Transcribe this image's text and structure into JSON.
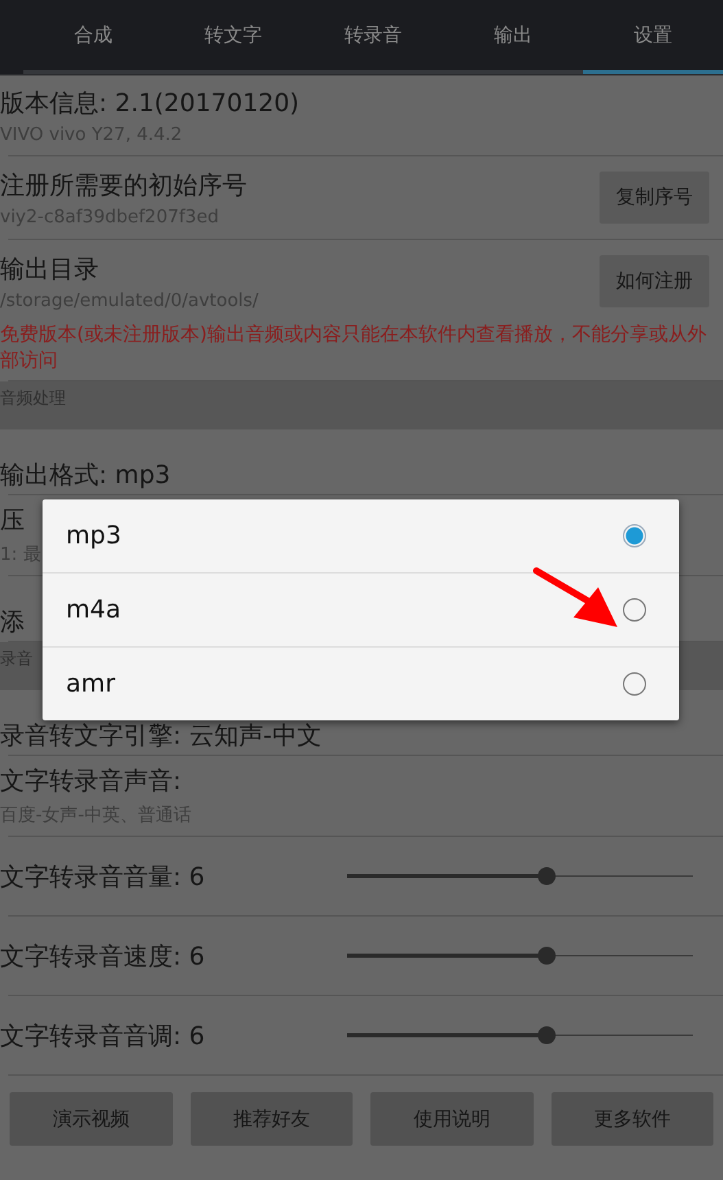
{
  "tabs": [
    {
      "label": "合成",
      "selected": false
    },
    {
      "label": "转文字",
      "selected": false
    },
    {
      "label": "转录音",
      "selected": false
    },
    {
      "label": "输出",
      "selected": false
    },
    {
      "label": "设置",
      "selected": true
    }
  ],
  "settings": [
    {
      "kind": "info",
      "title": "版本信息: 2.1(20170120)",
      "subtitle": "VIVO vivo Y27, 4.4.2"
    },
    {
      "kind": "button",
      "title": "注册所需要的初始序号",
      "subtitle": "viy2-c8af39dbef207f3ed",
      "button": "复制序号"
    },
    {
      "kind": "button",
      "title": "输出目录",
      "subtitle": "/storage/emulated/0/avtools/",
      "button": "如何注册",
      "warning": "免费版本(或未注册版本)输出音频或内容只能在本软件内查看播放，不能分享或从外部访问"
    },
    {
      "kind": "header",
      "title": "音频处理"
    },
    {
      "kind": "info",
      "title": "输出格式: mp3"
    },
    {
      "kind": "info",
      "title": "压",
      "subtitle": "1: 最"
    },
    {
      "kind": "info",
      "title": "添"
    },
    {
      "kind": "header",
      "title": "录音"
    },
    {
      "kind": "info",
      "title": "录音转文字引擎: 云知声-中文"
    },
    {
      "kind": "info",
      "title": "文字转录音声音:",
      "subtitle": "百度-女声-中英、普通话"
    },
    {
      "kind": "slider",
      "title": "文字转录音音量: 6",
      "level": 0.55
    },
    {
      "kind": "slider",
      "title": "文字转录音速度: 6",
      "level": 0.55
    },
    {
      "kind": "slider",
      "title": "文字转录音音调: 6",
      "level": 0.55
    }
  ],
  "bottom_buttons": [
    "演示视频",
    "推荐好友",
    "使用说明",
    "更多软件"
  ],
  "dialog": {
    "options": [
      {
        "label": "mp3",
        "selected": true
      },
      {
        "label": "m4a",
        "selected": false
      },
      {
        "label": "amr",
        "selected": false
      }
    ]
  }
}
